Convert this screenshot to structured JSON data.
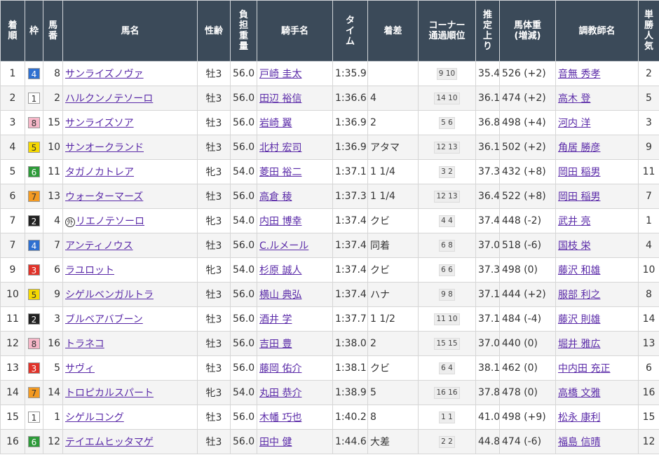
{
  "headers": [
    "着\n順",
    "枠",
    "馬\n番",
    "馬名",
    "性齢",
    "負\n担\n重\n量",
    "騎手名",
    "タ\nイ\nム",
    "着差",
    "コーナー\n通過順位",
    "推\n定\n上\nり",
    "馬体重\n(増減)",
    "調教師名",
    "単\n勝\n人\n気"
  ],
  "waku_colors": {
    "1": {
      "bg": "#ffffff",
      "fg": "#333333"
    },
    "2": {
      "bg": "#222222",
      "fg": "#ffffff"
    },
    "3": {
      "bg": "#e0332a",
      "fg": "#ffffff"
    },
    "4": {
      "bg": "#2f70d0",
      "fg": "#ffffff"
    },
    "5": {
      "bg": "#f4d800",
      "fg": "#333333"
    },
    "6": {
      "bg": "#2e9a3a",
      "fg": "#ffffff"
    },
    "7": {
      "bg": "#f39a22",
      "fg": "#333333"
    },
    "8": {
      "bg": "#f6b7c8",
      "fg": "#333333"
    }
  },
  "rows": [
    {
      "rank": "1",
      "waku": "4",
      "umaban": "8",
      "name": "サンライズノヴァ",
      "mark": "",
      "sexage": "牡3",
      "weight": "56.0",
      "jockey": "戸崎 圭太",
      "time": "1:35.9",
      "margin": "",
      "corner": "9 10",
      "last3f": "35.4",
      "bodyweight": "526 (+2)",
      "trainer": "音無 秀孝",
      "pop": "2"
    },
    {
      "rank": "2",
      "waku": "1",
      "umaban": "2",
      "name": "ハルクンノテソーロ",
      "mark": "",
      "sexage": "牡3",
      "weight": "56.0",
      "jockey": "田辺 裕信",
      "time": "1:36.6",
      "margin": "4",
      "corner": "14 10",
      "last3f": "36.1",
      "bodyweight": "474 (+2)",
      "trainer": "高木 登",
      "pop": "5"
    },
    {
      "rank": "3",
      "waku": "8",
      "umaban": "15",
      "name": "サンライズソア",
      "mark": "",
      "sexage": "牡3",
      "weight": "56.0",
      "jockey": "岩崎 翼",
      "time": "1:36.9",
      "margin": "2",
      "corner": "5 6",
      "last3f": "36.8",
      "bodyweight": "498 (+4)",
      "trainer": "河内 洋",
      "pop": "3"
    },
    {
      "rank": "4",
      "waku": "5",
      "umaban": "10",
      "name": "サンオークランド",
      "mark": "",
      "sexage": "牡3",
      "weight": "56.0",
      "jockey": "北村 宏司",
      "time": "1:36.9",
      "margin": "アタマ",
      "corner": "12 13",
      "last3f": "36.1",
      "bodyweight": "502 (+2)",
      "trainer": "角居 勝彦",
      "pop": "9"
    },
    {
      "rank": "5",
      "waku": "6",
      "umaban": "11",
      "name": "タガノカトレア",
      "mark": "",
      "sexage": "牝3",
      "weight": "54.0",
      "jockey": "菱田 裕二",
      "time": "1:37.1",
      "margin": "1 1/4",
      "corner": "3 2",
      "last3f": "37.3",
      "bodyweight": "432 (+8)",
      "trainer": "岡田 稲男",
      "pop": "11"
    },
    {
      "rank": "6",
      "waku": "7",
      "umaban": "13",
      "name": "ウォーターマーズ",
      "mark": "",
      "sexage": "牡3",
      "weight": "56.0",
      "jockey": "高倉 稜",
      "time": "1:37.3",
      "margin": "1 1/4",
      "corner": "12 13",
      "last3f": "36.4",
      "bodyweight": "522 (+8)",
      "trainer": "岡田 稲男",
      "pop": "7"
    },
    {
      "rank": "7",
      "waku": "2",
      "umaban": "4",
      "name": "リエノテソーロ",
      "mark": "外",
      "sexage": "牝3",
      "weight": "54.0",
      "jockey": "内田 博幸",
      "time": "1:37.4",
      "margin": "クビ",
      "corner": "4 4",
      "last3f": "37.4",
      "bodyweight": "448 (-2)",
      "trainer": "武井 亮",
      "pop": "1"
    },
    {
      "rank": "7",
      "waku": "4",
      "umaban": "7",
      "name": "アンティノウス",
      "mark": "",
      "sexage": "牡3",
      "weight": "56.0",
      "jockey": "C.ルメール",
      "time": "1:37.4",
      "margin": "同着",
      "corner": "6 8",
      "last3f": "37.0",
      "bodyweight": "518 (-6)",
      "trainer": "国枝 栄",
      "pop": "4"
    },
    {
      "rank": "9",
      "waku": "3",
      "umaban": "6",
      "name": "ラユロット",
      "mark": "",
      "sexage": "牝3",
      "weight": "54.0",
      "jockey": "杉原 誠人",
      "time": "1:37.4",
      "margin": "クビ",
      "corner": "6 6",
      "last3f": "37.3",
      "bodyweight": "498 (0)",
      "trainer": "藤沢 和雄",
      "pop": "10"
    },
    {
      "rank": "10",
      "waku": "5",
      "umaban": "9",
      "name": "シゲルベンガルトラ",
      "mark": "",
      "sexage": "牡3",
      "weight": "56.0",
      "jockey": "横山 典弘",
      "time": "1:37.4",
      "margin": "ハナ",
      "corner": "9 8",
      "last3f": "37.1",
      "bodyweight": "444 (+2)",
      "trainer": "服部 利之",
      "pop": "8"
    },
    {
      "rank": "11",
      "waku": "2",
      "umaban": "3",
      "name": "ブルベアバブーン",
      "mark": "",
      "sexage": "牡3",
      "weight": "56.0",
      "jockey": "酒井 学",
      "time": "1:37.7",
      "margin": "1 1/2",
      "corner": "11 10",
      "last3f": "37.1",
      "bodyweight": "484 (-4)",
      "trainer": "藤沢 則雄",
      "pop": "14"
    },
    {
      "rank": "12",
      "waku": "8",
      "umaban": "16",
      "name": "トラネコ",
      "mark": "",
      "sexage": "牡3",
      "weight": "56.0",
      "jockey": "吉田 豊",
      "time": "1:38.0",
      "margin": "2",
      "corner": "15 15",
      "last3f": "37.0",
      "bodyweight": "440 (0)",
      "trainer": "堀井 雅広",
      "pop": "13"
    },
    {
      "rank": "13",
      "waku": "3",
      "umaban": "5",
      "name": "サヴィ",
      "mark": "",
      "sexage": "牡3",
      "weight": "56.0",
      "jockey": "藤岡 佑介",
      "time": "1:38.1",
      "margin": "クビ",
      "corner": "6 4",
      "last3f": "38.1",
      "bodyweight": "462 (0)",
      "trainer": "中内田 充正",
      "pop": "6"
    },
    {
      "rank": "14",
      "waku": "7",
      "umaban": "14",
      "name": "トロピカルスパート",
      "mark": "",
      "sexage": "牝3",
      "weight": "54.0",
      "jockey": "丸田 恭介",
      "time": "1:38.9",
      "margin": "5",
      "corner": "16 16",
      "last3f": "37.8",
      "bodyweight": "478 (0)",
      "trainer": "高橋 文雅",
      "pop": "16"
    },
    {
      "rank": "15",
      "waku": "1",
      "umaban": "1",
      "name": "シゲルコング",
      "mark": "",
      "sexage": "牡3",
      "weight": "56.0",
      "jockey": "木幡 巧也",
      "time": "1:40.2",
      "margin": "8",
      "corner": "1 1",
      "last3f": "41.0",
      "bodyweight": "498 (+9)",
      "trainer": "松永 康利",
      "pop": "15"
    },
    {
      "rank": "16",
      "waku": "6",
      "umaban": "12",
      "name": "テイエムヒッタマゲ",
      "mark": "",
      "sexage": "牡3",
      "weight": "56.0",
      "jockey": "田中 健",
      "time": "1:44.6",
      "margin": "大差",
      "corner": "2 2",
      "last3f": "44.8",
      "bodyweight": "474 (-6)",
      "trainer": "福島 信晴",
      "pop": "12"
    }
  ]
}
